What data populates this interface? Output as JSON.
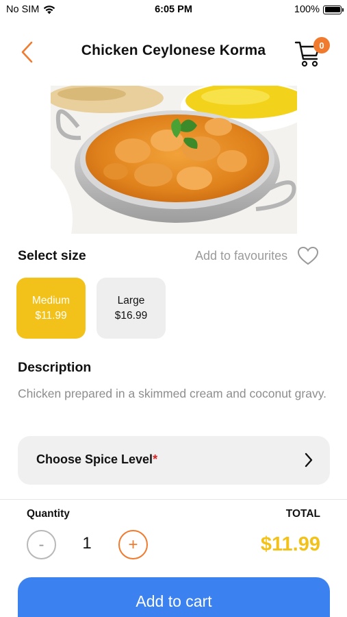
{
  "status_bar": {
    "carrier": "No SIM",
    "time": "6:05 PM",
    "battery": "100%",
    "battery_level": 1.0
  },
  "header": {
    "title": "Chicken Ceylonese Korma",
    "cart_count": "0",
    "back_icon": "chevron-left-icon",
    "cart_icon": "cart-icon"
  },
  "sizes": {
    "label": "Select size",
    "favourites_label": "Add to favourites",
    "options": [
      {
        "name": "Medium",
        "price": "$11.99",
        "selected": true
      },
      {
        "name": "Large",
        "price": "$16.99",
        "selected": false
      }
    ]
  },
  "description": {
    "label": "Description",
    "text": "Chicken prepared in a skimmed cream and coconut gravy."
  },
  "spice": {
    "label": "Choose Spice Level",
    "required_marker": "*"
  },
  "order": {
    "quantity_label": "Quantity",
    "quantity": "1",
    "minus": "-",
    "plus": "+",
    "total_label": "TOTAL",
    "total": "$11.99",
    "add_to_cart": "Add to cart"
  },
  "colors": {
    "accent_orange": "#f07a2e",
    "selected_yellow": "#f3c21a",
    "button_blue": "#3b82f0"
  }
}
